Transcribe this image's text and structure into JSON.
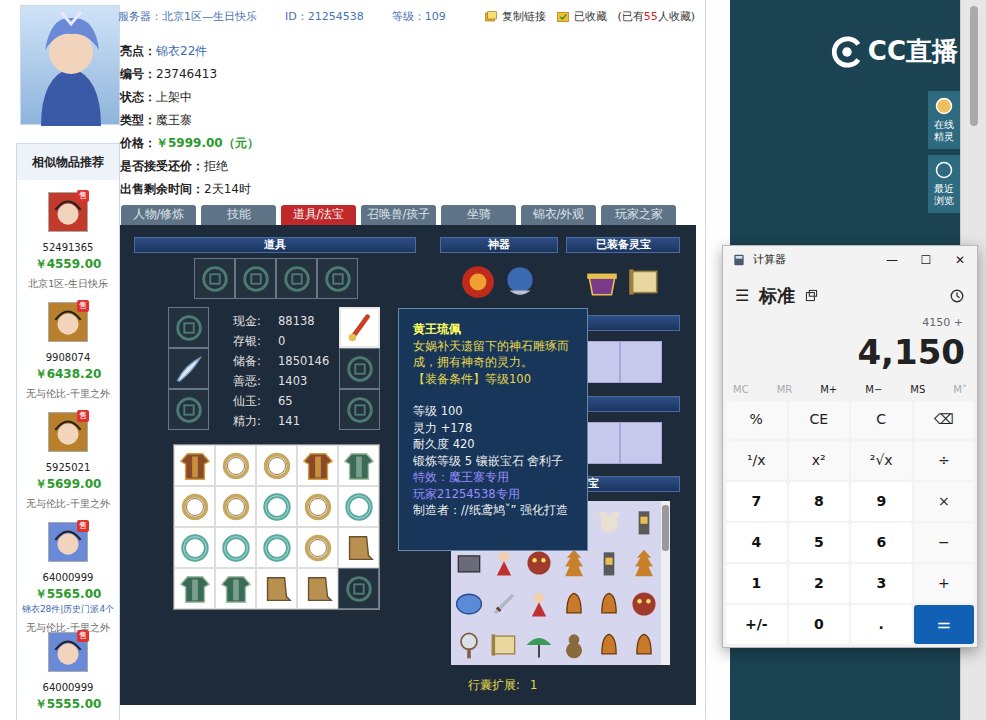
{
  "sidebar": {
    "title": "相似物品推荐",
    "items": [
      {
        "kind": "demon",
        "badge": "售",
        "id": "52491365",
        "price": "￥4559.00",
        "server": "北京1区-生日快乐"
      },
      {
        "kind": "lion",
        "badge": "售",
        "id": "9908074",
        "price": "￥6438.20",
        "server": "无与伦比-千里之外"
      },
      {
        "kind": "lion",
        "badge": "售",
        "id": "5925021",
        "price": "￥5699.00",
        "server": "无与伦比-千里之外"
      },
      {
        "kind": "fairy",
        "badge": "售",
        "id": "64000999",
        "price": "￥5565.00",
        "note": "锦衣28件|历史门派4个",
        "server": "无与伦比-千里之外"
      },
      {
        "kind": "fairy",
        "badge": "售",
        "id": "64000999",
        "price": "￥5555.00"
      }
    ]
  },
  "header": {
    "fields": [
      {
        "label": "服务器：",
        "value": "北京1区—生日快乐"
      },
      {
        "label": "ID：",
        "value": "21254538"
      },
      {
        "label": "等级：",
        "value": "109"
      }
    ],
    "copy": "复制链接",
    "fav": "已收藏",
    "count_prefix": "(已有",
    "count": "55",
    "count_suffix": "人收藏)"
  },
  "info": [
    {
      "label": "亮点：",
      "value": "锦衣22件",
      "kind": "link"
    },
    {
      "label": "编号：",
      "value": "23746413",
      "kind": "plain"
    },
    {
      "label": "状态：",
      "value": "上架中",
      "kind": "plain"
    },
    {
      "label": "类型：",
      "value": "魔王寨",
      "kind": "plain"
    },
    {
      "label": "价格：",
      "value": "￥5999.00（元）",
      "kind": "price"
    },
    {
      "label": "是否接受还价：",
      "value": "拒绝",
      "kind": "plain"
    },
    {
      "label": "出售剩余时间：",
      "value": "2天14时",
      "kind": "plain"
    }
  ],
  "tabs": [
    {
      "label": "人物/修炼",
      "selected": false
    },
    {
      "label": "技能",
      "selected": false
    },
    {
      "label": "道具/法宝",
      "selected": true
    },
    {
      "label": "召唤兽/孩子",
      "selected": false
    },
    {
      "label": "坐骑",
      "selected": false
    },
    {
      "label": "锦衣/外观",
      "selected": false
    },
    {
      "label": "玩家之家",
      "selected": false
    }
  ],
  "panel": {
    "props_title": "道具",
    "artifact_title": "神器",
    "lingbao_title": "已装备灵宝",
    "hidden_title_1": "宝",
    "hidden_title_2": "宝",
    "fabao_title": "法宝",
    "top_slots": [
      {
        "kind": "empty"
      },
      {
        "kind": "empty"
      },
      {
        "kind": "empty"
      },
      {
        "kind": "empty"
      }
    ],
    "left_slots": [
      {
        "kind": "empty",
        "selected": false
      },
      {
        "kind": "feather",
        "selected": false
      },
      {
        "kind": "empty",
        "selected": false
      }
    ],
    "right_slots": [
      {
        "kind": "pendant",
        "selected": true
      },
      {
        "kind": "empty",
        "selected": false
      },
      {
        "kind": "empty",
        "selected": false
      }
    ],
    "stats": [
      {
        "label": "现金:",
        "value": "88138"
      },
      {
        "label": "存银:",
        "value": "0"
      },
      {
        "label": "储备:",
        "value": "1850146"
      },
      {
        "label": "善恶:",
        "value": "1403"
      },
      {
        "label": "仙玉:",
        "value": "65"
      },
      {
        "label": "精力:",
        "value": "141"
      }
    ],
    "inventory": [
      {
        "kind": "armor"
      },
      {
        "kind": "ring"
      },
      {
        "kind": "ring"
      },
      {
        "kind": "armor"
      },
      {
        "kind": "armor-green"
      },
      {
        "kind": "ring"
      },
      {
        "kind": "ring"
      },
      {
        "kind": "bracelet"
      },
      {
        "kind": "ring"
      },
      {
        "kind": "bracelet"
      },
      {
        "kind": "bracelet"
      },
      {
        "kind": "bracelet"
      },
      {
        "kind": "bracelet"
      },
      {
        "kind": "ring"
      },
      {
        "kind": "boot"
      },
      {
        "kind": "armor-green"
      },
      {
        "kind": "armor-green"
      },
      {
        "kind": "boot"
      },
      {
        "kind": "boot"
      },
      {
        "kind": "empty"
      }
    ],
    "artifacts": [
      {
        "kind": "fireorb"
      },
      {
        "kind": "bowl"
      }
    ],
    "lingbao": [
      {
        "kind": "cauldron"
      },
      {
        "kind": "scroll"
      }
    ],
    "fabao": [
      {
        "kind": "box"
      },
      {
        "kind": "bear"
      },
      {
        "kind": "doll"
      },
      {
        "kind": "pagoda"
      },
      {
        "kind": "bear"
      },
      {
        "kind": "lantern"
      },
      {
        "kind": "box"
      },
      {
        "kind": "doll"
      },
      {
        "kind": "mask"
      },
      {
        "kind": "pagoda"
      },
      {
        "kind": "lantern"
      },
      {
        "kind": "pagoda"
      },
      {
        "kind": "orb"
      },
      {
        "kind": "sword"
      },
      {
        "kind": "doll"
      },
      {
        "kind": "bell"
      },
      {
        "kind": "bell"
      },
      {
        "kind": "mask"
      },
      {
        "kind": "mirror"
      },
      {
        "kind": "scroll"
      },
      {
        "kind": "umbrella"
      },
      {
        "kind": "gourd"
      },
      {
        "kind": "bell"
      },
      {
        "kind": "bell"
      }
    ],
    "expand_label": "行囊扩展:",
    "expand_value": "1"
  },
  "tooltip": {
    "title": "黄王琉佩",
    "desc": "女娲补天遗留下的神石雕琢而成，拥有神奇的灵力。",
    "requirement": "【装备条件】等级100",
    "lines": [
      {
        "text": "等级 100",
        "kind": "stat"
      },
      {
        "text": "灵力 +178",
        "kind": "stat"
      },
      {
        "text": "耐久度 420",
        "kind": "stat"
      },
      {
        "text": "锻炼等级 5 镶嵌宝石 舍利子",
        "kind": "stat"
      },
      {
        "text": "特效：魔王寨专用",
        "kind": "effect"
      },
      {
        "text": "玩家21254538专用",
        "kind": "effect"
      },
      {
        "text": "制造者：//纸鸢鸠ˇ” 强化打造",
        "kind": "maker"
      }
    ]
  },
  "livestream": {
    "logo": "CC直播",
    "buttons": [
      {
        "label": "在线精灵"
      },
      {
        "label": "最近浏览"
      }
    ]
  },
  "calculator": {
    "title": "计算器",
    "controls": [
      "—",
      "☐",
      "✕"
    ],
    "menu": "☰",
    "mode": "标准",
    "expression": "4150 +",
    "display": "4,150",
    "memory": [
      {
        "label": "MC",
        "disabled": true
      },
      {
        "label": "MR",
        "disabled": true
      },
      {
        "label": "M+",
        "disabled": false
      },
      {
        "label": "M−",
        "disabled": false
      },
      {
        "label": "MS",
        "disabled": false
      },
      {
        "label": "M˅",
        "disabled": true
      }
    ],
    "keys": [
      {
        "label": "%",
        "kind": "op"
      },
      {
        "label": "CE",
        "kind": "op"
      },
      {
        "label": "C",
        "kind": "op"
      },
      {
        "label": "⌫",
        "kind": "op"
      },
      {
        "label": "¹/x",
        "kind": "op"
      },
      {
        "label": "x²",
        "kind": "op"
      },
      {
        "label": "²√x",
        "kind": "op"
      },
      {
        "label": "÷",
        "kind": "op"
      },
      {
        "label": "7",
        "kind": "digit"
      },
      {
        "label": "8",
        "kind": "digit"
      },
      {
        "label": "9",
        "kind": "digit"
      },
      {
        "label": "×",
        "kind": "op"
      },
      {
        "label": "4",
        "kind": "digit"
      },
      {
        "label": "5",
        "kind": "digit"
      },
      {
        "label": "6",
        "kind": "digit"
      },
      {
        "label": "−",
        "kind": "op"
      },
      {
        "label": "1",
        "kind": "digit"
      },
      {
        "label": "2",
        "kind": "digit"
      },
      {
        "label": "3",
        "kind": "digit"
      },
      {
        "label": "+",
        "kind": "op"
      },
      {
        "label": "+/-",
        "kind": "digit"
      },
      {
        "label": "0",
        "kind": "digit"
      },
      {
        "label": ".",
        "kind": "digit"
      },
      {
        "label": "=",
        "kind": "equals"
      }
    ]
  }
}
